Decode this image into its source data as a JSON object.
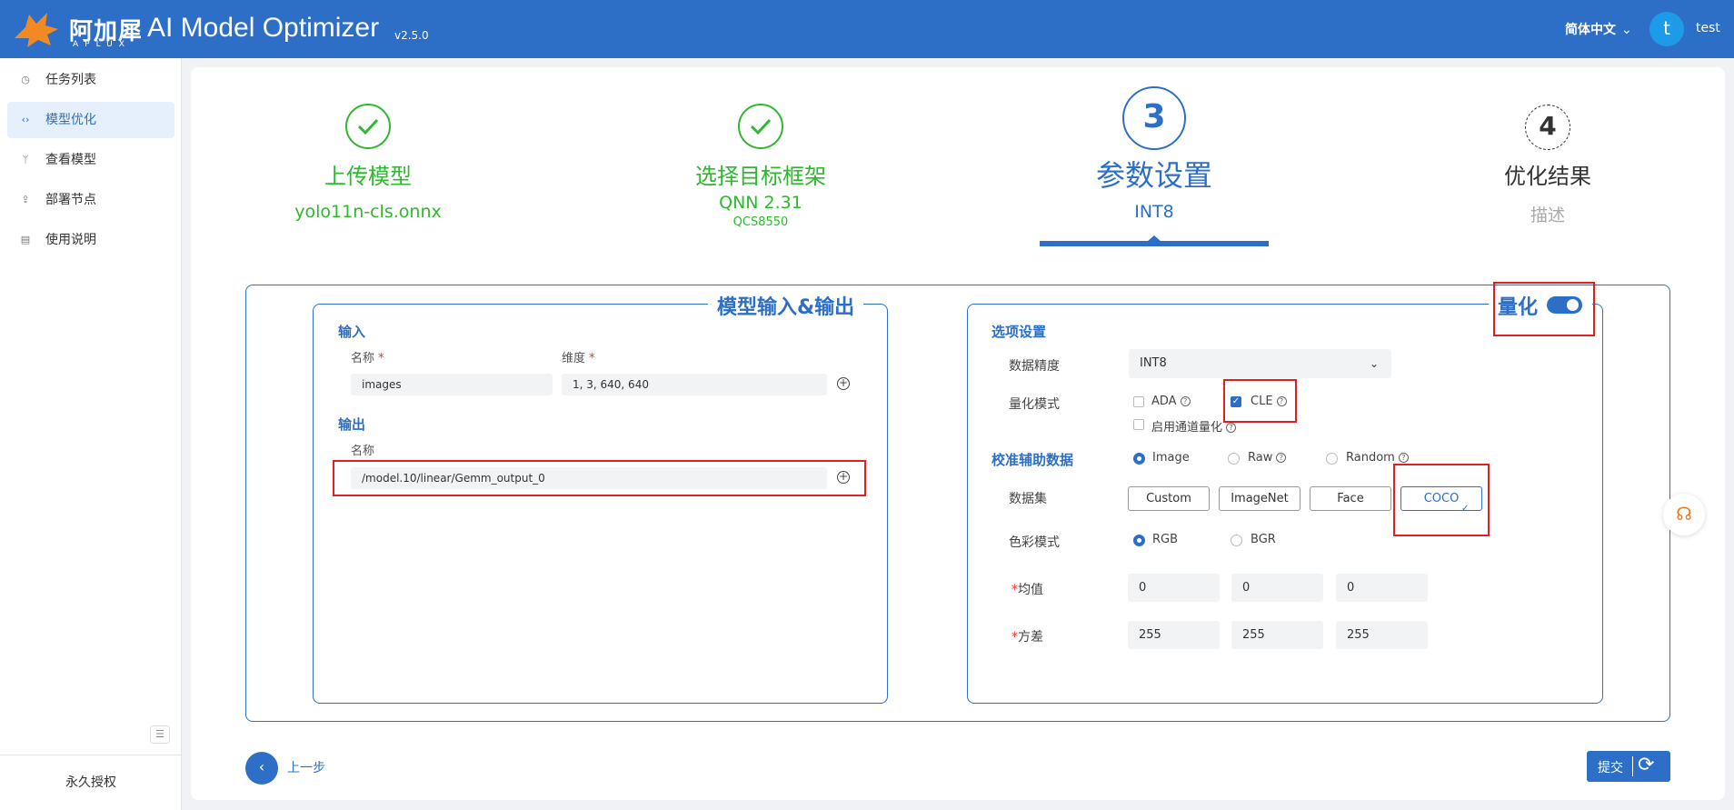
{
  "header": {
    "brand_cn": "阿加犀",
    "brand_en": "APLUX",
    "title": "AI Model Optimizer",
    "version": "v2.5.0",
    "language": "简体中文",
    "avatar_letter": "t",
    "username": "test",
    "bg_color": "#2d6fc7"
  },
  "sidebar": {
    "items": [
      {
        "label": "任务列表",
        "icon": "history-icon",
        "active": false
      },
      {
        "label": "模型优化",
        "icon": "code-icon",
        "active": true
      },
      {
        "label": "查看模型",
        "icon": "branch-icon",
        "active": false
      },
      {
        "label": "部署节点",
        "icon": "upload-icon",
        "active": false
      },
      {
        "label": "使用说明",
        "icon": "doc-icon",
        "active": false
      }
    ],
    "license": "永久授权"
  },
  "steps": [
    {
      "number": "1",
      "title": "上传模型",
      "sub": "yolo11n-cls.onnx",
      "sub2": "",
      "status": "done"
    },
    {
      "number": "2",
      "title": "选择目标框架",
      "sub": "QNN 2.31",
      "sub2": "QCS8550",
      "status": "done"
    },
    {
      "number": "3",
      "title": "参数设置",
      "sub": "INT8",
      "sub2": "",
      "status": "current"
    },
    {
      "number": "4",
      "title": "优化结果",
      "sub": "描述",
      "sub2": "",
      "status": "todo"
    }
  ],
  "io_panel": {
    "legend": "模型输入&输出",
    "input_section": "输入",
    "name_label": "名称",
    "dim_label": "维度",
    "input_name": "images",
    "input_dims": "1, 3, 640, 640",
    "output_section": "输出",
    "output_name_label": "名称",
    "output_name": "/model.10/linear/Gemm_output_0"
  },
  "quant_panel": {
    "legend": "量化",
    "toggle_on": true,
    "options_section": "选项设置",
    "precision_label": "数据精度",
    "precision_value": "INT8",
    "mode_label": "量化模式",
    "mode_options": [
      {
        "label": "ADA",
        "checked": false
      },
      {
        "label": "CLE",
        "checked": true
      },
      {
        "label": "启用通道量化",
        "checked": false
      }
    ],
    "calib_section": "校准辅助数据",
    "calib_options": [
      {
        "label": "Image",
        "selected": true
      },
      {
        "label": "Raw",
        "selected": false
      },
      {
        "label": "Random",
        "selected": false
      }
    ],
    "dataset_label": "数据集",
    "datasets": [
      "Custom",
      "ImageNet",
      "Face",
      "COCO"
    ],
    "dataset_selected": "COCO",
    "color_label": "色彩模式",
    "color_options": [
      {
        "label": "RGB",
        "selected": true
      },
      {
        "label": "BGR",
        "selected": false
      }
    ],
    "mean_label": "均值",
    "mean_values": [
      "0",
      "0",
      "0"
    ],
    "std_label": "方差",
    "std_values": [
      "255",
      "255",
      "255"
    ]
  },
  "footer": {
    "back_label": "上一步",
    "submit_label": "提交"
  }
}
